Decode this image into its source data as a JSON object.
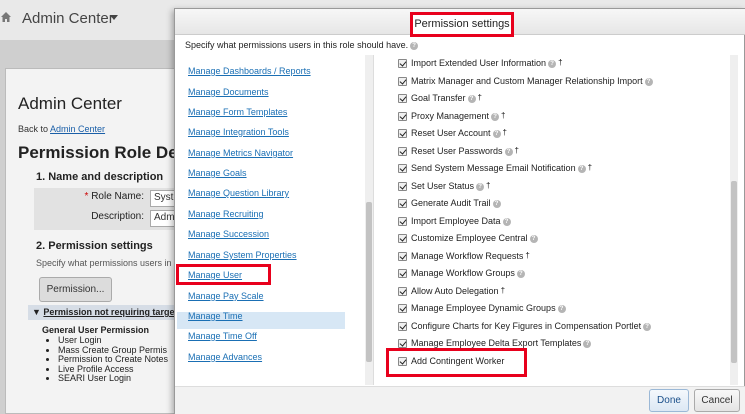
{
  "topbar": {
    "title": "Admin Center",
    "home_icon": "home-icon"
  },
  "background": {
    "heading": "Admin Center",
    "back_prefix": "Back to ",
    "back_link": "Admin Center",
    "page_heading": "Permission Role Det",
    "section1": "1. Name and description",
    "role_name_label": "Role Name:",
    "role_name_value": "Syste",
    "description_label": "Description:",
    "description_value": "Admi",
    "section2": "2. Permission settings",
    "section2_text": "Specify what permissions users in th",
    "permission_button": "Permission...",
    "note_link": "Permission not requiring targe",
    "general_heading": "General User Permission",
    "general_items": [
      "User Login",
      "Mass Create Group Permis",
      "Permission to Create Notes",
      "Live Profile Access",
      "SEARI User Login"
    ]
  },
  "modal": {
    "title": "Permission settings",
    "description": "Specify what permissions users in this role should have.",
    "left_links": [
      "Manage Dashboards / Reports",
      "Manage Documents",
      "Manage Form Templates",
      "Manage Integration Tools",
      "Manage Metrics Navigator",
      "Manage Goals",
      "Manage Question Library",
      "Manage Recruiting",
      "Manage Succession",
      "Manage System Properties",
      "Manage User",
      "Manage Pay Scale",
      "Manage Time",
      "Manage Time Off",
      "Manage Advances"
    ],
    "selected_link": "Manage User",
    "permissions": [
      "Import Extended User Information",
      "Matrix Manager and Custom Manager Relationship Import",
      "Goal Transfer",
      "Proxy Management",
      "Reset User Account",
      "Reset User Passwords",
      "Send System Message Email Notification",
      "Set User Status",
      "Generate Audit Trail",
      "Import Employee Data",
      "Customize Employee Central",
      "Manage Workflow Requests",
      "Manage Workflow Groups",
      "Allow Auto Delegation",
      "Manage Employee Dynamic Groups",
      "Configure Charts for Key Figures in Compensation Portlet",
      "Manage Employee Delta Export Templates",
      "Add Contingent Worker"
    ],
    "dagger": "†",
    "done": "Done",
    "cancel": "Cancel",
    "highlight_color": "#e8001c"
  }
}
